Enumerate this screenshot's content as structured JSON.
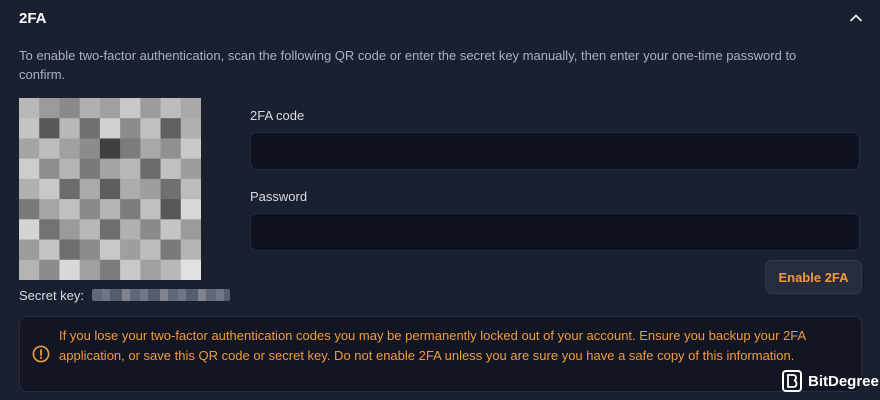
{
  "section": {
    "title": "2FA",
    "description": "To enable two-factor authentication, scan the following QR code or enter the secret key manually, then enter your one-time password to confirm."
  },
  "qr": {
    "cells": [
      "#b8b8b8",
      "#9a9a9a",
      "#8a8a8a",
      "#b0b0b0",
      "#a0a0a0",
      "#c8c8c8",
      "#9c9c9c",
      "#bcbcbc",
      "#a8a8a8",
      "#c4c4c4",
      "#585858",
      "#b8b8b8",
      "#707070",
      "#d0d0d0",
      "#8c8c8c",
      "#c0c0c0",
      "#606060",
      "#b0b0b0",
      "#a4a4a4",
      "#bdbdbd",
      "#a0a0a0",
      "#8c8c8c",
      "#404040",
      "#7c7c7c",
      "#a8a8a8",
      "#909090",
      "#c8c8c8",
      "#cccccc",
      "#8e8e8e",
      "#b4b4b4",
      "#7a7a7a",
      "#a4a4a4",
      "#b8b8b8",
      "#6c6c6c",
      "#c0c0c0",
      "#9c9c9c",
      "#b0b0b0",
      "#c8c8c8",
      "#6c6c6c",
      "#aaaaaa",
      "#5e5e5e",
      "#acacac",
      "#9e9e9e",
      "#707070",
      "#bcbcbc",
      "#7a7a7a",
      "#a6a6a6",
      "#c0c0c0",
      "#8a8a8a",
      "#b4b4b4",
      "#7c7c7c",
      "#c0c0c0",
      "#585858",
      "#d8d8d8",
      "#d4d4d4",
      "#727272",
      "#9a9a9a",
      "#b8b8b8",
      "#6e6e6e",
      "#b0b0b0",
      "#8a8a8a",
      "#c4c4c4",
      "#9a9a9a",
      "#9c9c9c",
      "#c4c4c4",
      "#6e6e6e",
      "#8c8c8c",
      "#c8c8c8",
      "#9e9e9e",
      "#bdbdbd",
      "#7a7a7a",
      "#b4b4b4",
      "#b4b4b4",
      "#8c8c8c",
      "#d8d8d8",
      "#a0a0a0",
      "#7c7c7c",
      "#c8c8c8",
      "#a0a0a0",
      "#b8b8b8",
      "#e0e0e0"
    ]
  },
  "secret": {
    "label": "Secret key:"
  },
  "fields": {
    "code_label": "2FA code",
    "code_value": "",
    "password_label": "Password",
    "password_value": ""
  },
  "actions": {
    "enable_label": "Enable 2FA"
  },
  "warning": {
    "text": "If you lose your two-factor authentication codes you may be permanently locked out of your account. Ensure you backup your 2FA application, or save this QR code or secret key. Do not enable 2FA unless you are sure you have a safe copy of this information."
  },
  "watermark": {
    "brand": "BitDegree"
  },
  "colors": {
    "background": "#1b2030",
    "input_bg": "#0f1320",
    "accent": "#f29a3b",
    "muted_text": "#aab0c0"
  },
  "icons": {
    "collapse": "chevron-up-icon",
    "warning": "alert-circle-icon",
    "logo": "bitdegree-logo-icon"
  }
}
